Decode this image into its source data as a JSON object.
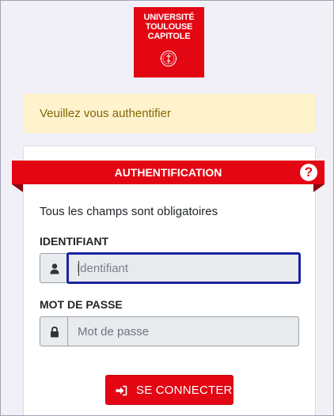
{
  "logo": {
    "line1": "UNIVERSITÉ",
    "line2": "TOULOUSE",
    "line3": "CAPITOLE"
  },
  "alert": {
    "message": "Veuillez vous authentifier"
  },
  "panel": {
    "title": "AUTHENTIFICATION",
    "help_icon": "question-circle-icon",
    "mandatory_note": "Tous les champs sont obligatoires"
  },
  "username": {
    "label": "IDENTIFIANT",
    "placeholder": "Identifiant",
    "value": "",
    "icon": "user-icon"
  },
  "password": {
    "label": "MOT DE PASSE",
    "placeholder": "Mot de passe",
    "value": "",
    "icon": "lock-icon"
  },
  "submit": {
    "label": "SE CONNECTER",
    "icon": "sign-in-icon"
  },
  "colors": {
    "brand_red": "#e30613",
    "focus_border": "#1a23a0",
    "alert_bg": "#fff3cd",
    "alert_text": "#856404"
  }
}
